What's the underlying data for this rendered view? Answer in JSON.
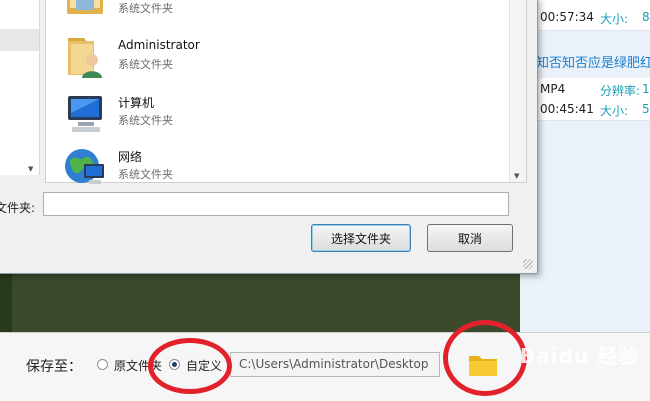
{
  "background_app": {
    "row1": {
      "time": "00:57:34",
      "size_label": "大小:",
      "cut": "8"
    },
    "link_title": "知否知否应是绿肥红",
    "row2": {
      "format": "MP4",
      "resolution_label": "分辨率:",
      "time": "00:45:41",
      "size_label": "大小:",
      "cut1": "1",
      "cut2": "5"
    }
  },
  "dialog": {
    "items": [
      {
        "name": "",
        "sub": "系统文件夹",
        "icon": "library-folder-icon"
      },
      {
        "name": "Administrator",
        "sub": "系统文件夹",
        "icon": "user-folder-icon"
      },
      {
        "name": "计算机",
        "sub": "系统文件夹",
        "icon": "computer-icon"
      },
      {
        "name": "网络",
        "sub": "系统文件夹",
        "icon": "network-icon"
      }
    ],
    "folder_label": "文件夹:",
    "folder_value": "",
    "ok_label": "选择文件夹",
    "cancel_label": "取消"
  },
  "save_bar": {
    "label": "保存至：",
    "option_original": "原文件夹",
    "option_custom": "自定义",
    "selected": "custom",
    "path": "C:\\Users\\Administrator\\Desktop",
    "folder_button_icon": "folder-icon"
  },
  "annotations": {
    "circle_color": "#e2212a"
  },
  "watermark": "Baidu 经验"
}
